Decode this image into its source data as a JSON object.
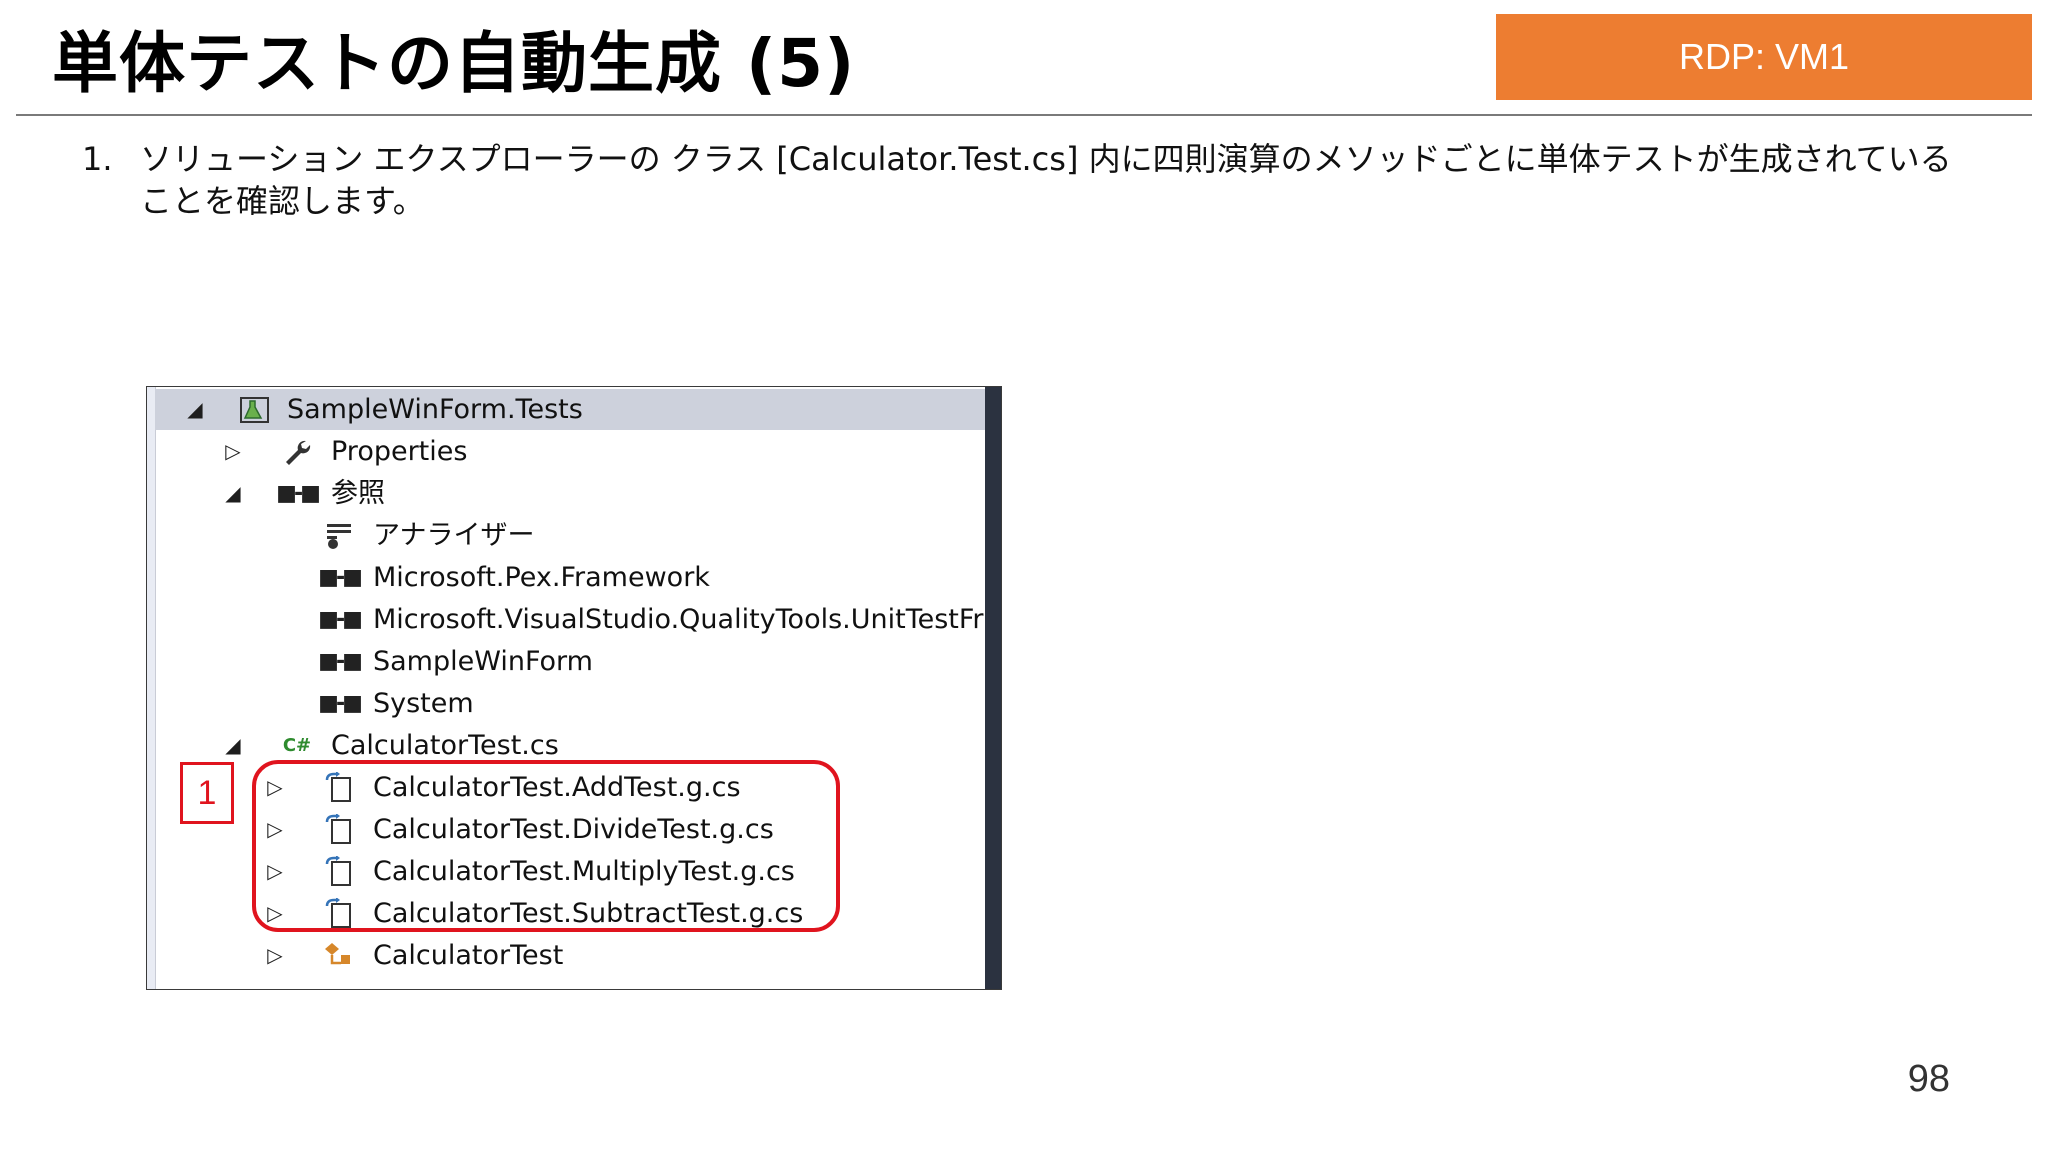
{
  "slide": {
    "title": "単体テストの自動生成 (5)",
    "badge": "RDP: VM1",
    "page_number": "98"
  },
  "instruction": {
    "number": "1.",
    "text": "ソリューション エクスプローラーの クラス [Calculator.Test.cs] 内に四則演算のメソッドごとに単体テストが生成されていることを確認します。"
  },
  "step_marker": "1",
  "explorer": {
    "items": [
      {
        "label": "SampleWinForm.Tests",
        "expander": "◢",
        "icon": "test-project-icon",
        "selected": true
      },
      {
        "label": "Properties",
        "expander": "▷",
        "icon": "wrench-icon"
      },
      {
        "label": "参照",
        "expander": "◢",
        "icon": "reference-icon"
      },
      {
        "label": "アナライザー",
        "expander": "",
        "icon": "analyzer-icon"
      },
      {
        "label": "Microsoft.Pex.Framework",
        "expander": "",
        "icon": "reference-icon"
      },
      {
        "label": "Microsoft.VisualStudio.QualityTools.UnitTestFramework",
        "expander": "",
        "icon": "reference-icon"
      },
      {
        "label": "SampleWinForm",
        "expander": "",
        "icon": "reference-icon"
      },
      {
        "label": "System",
        "expander": "",
        "icon": "reference-icon"
      },
      {
        "label": "CalculatorTest.cs",
        "expander": "◢",
        "icon": "csharp-file-icon"
      },
      {
        "label": "CalculatorTest.AddTest.g.cs",
        "expander": "▷",
        "icon": "generated-file-icon"
      },
      {
        "label": "CalculatorTest.DivideTest.g.cs",
        "expander": "▷",
        "icon": "generated-file-icon"
      },
      {
        "label": "CalculatorTest.MultiplyTest.g.cs",
        "expander": "▷",
        "icon": "generated-file-icon"
      },
      {
        "label": "CalculatorTest.SubtractTest.g.cs",
        "expander": "▷",
        "icon": "generated-file-icon"
      },
      {
        "label": "CalculatorTest",
        "expander": "▷",
        "icon": "class-icon"
      }
    ]
  }
}
